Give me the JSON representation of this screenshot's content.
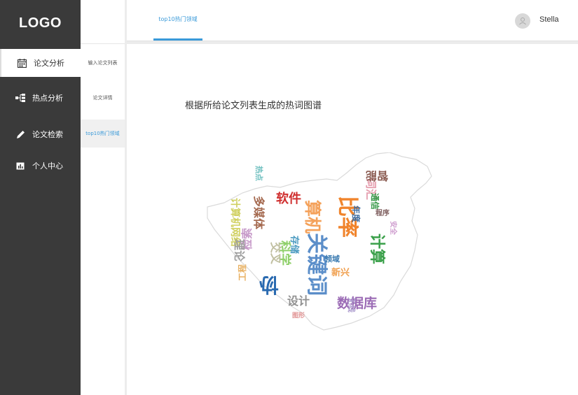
{
  "sidebar": {
    "logo": "LOGO",
    "items": [
      {
        "label": "论文分析",
        "icon": "calendar-icon"
      },
      {
        "label": "热点分析",
        "icon": "network-icon"
      },
      {
        "label": "论文检索",
        "icon": "pencil-icon"
      },
      {
        "label": "个人中心",
        "icon": "chart-icon"
      }
    ]
  },
  "subnav": {
    "items": [
      {
        "label": "输入论文列表"
      },
      {
        "label": "论文详情"
      },
      {
        "label": "top10热门领域"
      }
    ]
  },
  "header": {
    "tab": "top10热门领域",
    "user": "Stella"
  },
  "main": {
    "heading": "根据所给论文列表生成的热词图谱"
  },
  "wordcloud": {
    "words": [
      {
        "text": "关键词",
        "color": "#5b8ec9"
      },
      {
        "text": "计算",
        "color": "#3aa04a"
      },
      {
        "text": "比率",
        "color": "#f0842c"
      },
      {
        "text": "算机",
        "color": "#f4a15a"
      },
      {
        "text": "数据库",
        "color": "#9b6bb5"
      },
      {
        "text": "软件",
        "color": "#d03030"
      },
      {
        "text": "科学",
        "color": "#8fd06a"
      },
      {
        "text": "多媒体",
        "color": "#a56a50"
      },
      {
        "text": "检索",
        "color": "#c79ac9"
      },
      {
        "text": "计算机网络",
        "color": "#d0d060"
      },
      {
        "text": "词汇",
        "color": "#e6a0b0"
      },
      {
        "text": "智能",
        "color": "#8a5a50"
      },
      {
        "text": "理论",
        "color": "#a0a0a0"
      },
      {
        "text": "交叉",
        "color": "#c0bfa0"
      },
      {
        "text": "存储",
        "color": "#4a9ac0"
      },
      {
        "text": "领域",
        "color": "#3a7ab0"
      },
      {
        "text": "新兴",
        "color": "#f0a050"
      },
      {
        "text": "设计",
        "color": "#909090"
      },
      {
        "text": "年度",
        "color": "#3a6aa0"
      },
      {
        "text": "通信",
        "color": "#3a9a4a"
      },
      {
        "text": "程序",
        "color": "#806060"
      },
      {
        "text": "工程",
        "color": "#e8b060"
      },
      {
        "text": "协",
        "color": "#2a6ab0"
      },
      {
        "text": "热点",
        "color": "#70c0c0"
      },
      {
        "text": "无线",
        "color": "#b0a0d0"
      },
      {
        "text": "图形",
        "color": "#e09090"
      },
      {
        "text": "安全",
        "color": "#d0a0d0"
      }
    ]
  }
}
